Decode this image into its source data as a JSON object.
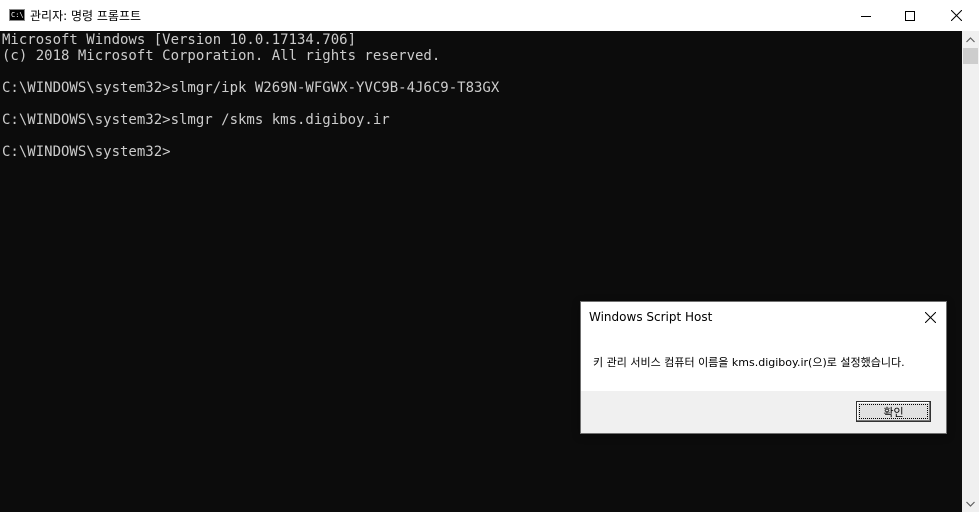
{
  "window": {
    "title": "관리자: 명령 프롬프트",
    "icon_label": "C:\\",
    "buttons": [
      "minimize-icon",
      "maximize-icon",
      "close-icon"
    ]
  },
  "console": {
    "lines": [
      "Microsoft Windows [Version 10.0.17134.706]",
      "(c) 2018 Microsoft Corporation. All rights reserved.",
      "",
      "C:\\WINDOWS\\system32>slmgr/ipk W269N-WFGWX-YVC9B-4J6C9-T83GX",
      "",
      "C:\\WINDOWS\\system32>slmgr /skms kms.digiboy.ir",
      "",
      "C:\\WINDOWS\\system32>"
    ],
    "background": "#0c0c0c",
    "foreground": "#cccccc"
  },
  "dialog": {
    "title": "Windows Script Host",
    "message": "키 관리 서비스 컴퓨터 이름을 kms.digiboy.ir(으)로 설정했습니다.",
    "ok_label": "확인"
  }
}
